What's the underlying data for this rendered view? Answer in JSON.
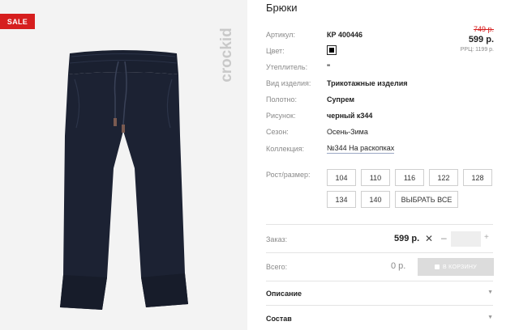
{
  "badge": {
    "sale": "SALE"
  },
  "brand": {
    "logo_text": "crockid"
  },
  "product": {
    "title": "Брюки",
    "old_price": "749 р.",
    "price": "599 р.",
    "rrp": "РРЦ: 1199 р."
  },
  "attributes": [
    {
      "label": "Артикул:",
      "value": "КР 400446"
    },
    {
      "label": "Цвет:",
      "value": "",
      "color": "#000000"
    },
    {
      "label": "Утеплитель:",
      "value": "\""
    },
    {
      "label": "Вид изделия:",
      "value": "Трикотажные изделия"
    },
    {
      "label": "Полотно:",
      "value": "Супрем"
    },
    {
      "label": "Рисунок:",
      "value": "черный к344"
    },
    {
      "label": "Сезон:",
      "value": "Осень-Зима"
    },
    {
      "label": "Коллекция:",
      "value": "№344 На раскопках"
    }
  ],
  "sizes": {
    "label": "Рост/размер:",
    "options": [
      "104",
      "110",
      "116",
      "122",
      "128",
      "134",
      "140"
    ],
    "select_all": "ВЫБРАТЬ ВСЕ"
  },
  "order": {
    "label": "Заказ:",
    "price": "599 р.",
    "quantity": "",
    "total_label": "Всего:",
    "total_value": "0 р.",
    "cart_button": "В КОРЗИНУ"
  },
  "sections": [
    {
      "label": "Описание"
    },
    {
      "label": "Состав"
    }
  ],
  "colors": {
    "sale": "#d61e1e",
    "pants": "#1c2233",
    "price_old": "#d61e1e"
  }
}
